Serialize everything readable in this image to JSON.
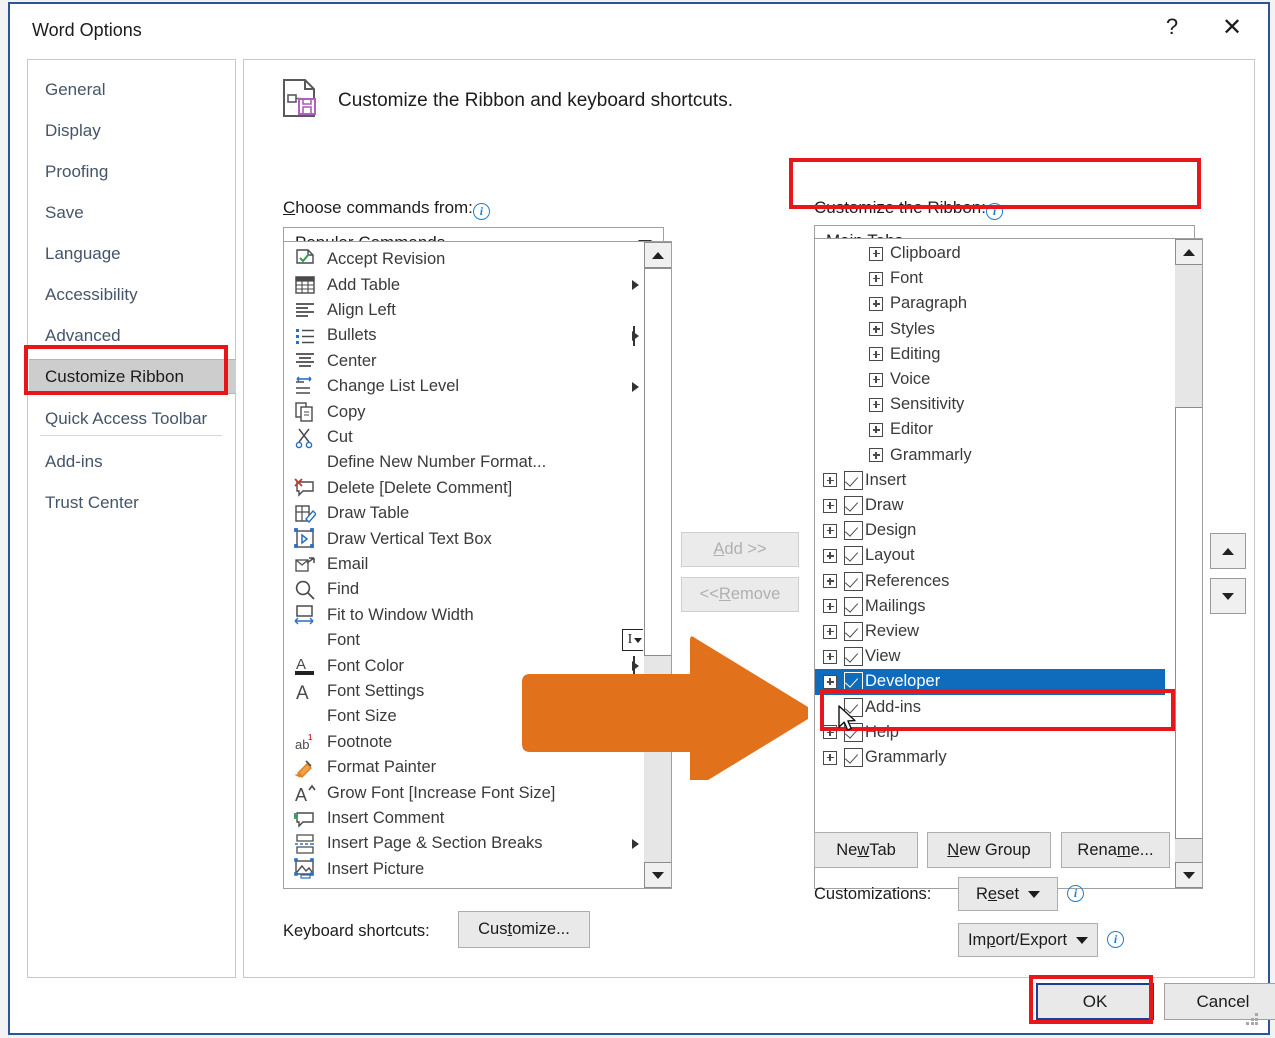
{
  "window": {
    "title": "Word Options",
    "help_button": "?",
    "close_button": "✕"
  },
  "sidebar": {
    "items": [
      {
        "label": "General",
        "selected": false
      },
      {
        "label": "Display",
        "selected": false
      },
      {
        "label": "Proofing",
        "selected": false
      },
      {
        "label": "Save",
        "selected": false
      },
      {
        "label": "Language",
        "selected": false
      },
      {
        "label": "Accessibility",
        "selected": false
      },
      {
        "label": "Advanced",
        "selected": false
      },
      {
        "label": "Customize Ribbon",
        "selected": true
      },
      {
        "label": "Quick Access Toolbar",
        "selected": false
      },
      {
        "label": "Add-ins",
        "selected": false
      },
      {
        "label": "Trust Center",
        "selected": false
      }
    ]
  },
  "header": {
    "title": "Customize the Ribbon and keyboard shortcuts.",
    "icon": "customize-ribbon-icon"
  },
  "left_panel": {
    "label_prefix": "C",
    "label_rest": "hoose commands from:",
    "combo_value": "Popular Commands",
    "commands": [
      {
        "label": "Accept Revision",
        "icon": "accept-revision-icon",
        "submenu": false
      },
      {
        "label": "Add Table",
        "icon": "add-table-icon",
        "submenu": true
      },
      {
        "label": "Align Left",
        "icon": "align-left-icon",
        "submenu": false
      },
      {
        "label": "Bullets",
        "icon": "bullets-icon",
        "submenu": true
      },
      {
        "label": "Center",
        "icon": "center-icon",
        "submenu": false
      },
      {
        "label": "Change List Level",
        "icon": "change-list-level-icon",
        "submenu": true
      },
      {
        "label": "Copy",
        "icon": "copy-icon",
        "submenu": false
      },
      {
        "label": "Cut",
        "icon": "cut-icon",
        "submenu": false
      },
      {
        "label": "Define New Number Format...",
        "icon": "none",
        "submenu": false
      },
      {
        "label": "Delete [Delete Comment]",
        "icon": "delete-comment-icon",
        "submenu": false
      },
      {
        "label": "Draw Table",
        "icon": "draw-table-icon",
        "submenu": false
      },
      {
        "label": "Draw Vertical Text Box",
        "icon": "draw-vertical-text-box-icon",
        "submenu": false
      },
      {
        "label": "Email",
        "icon": "email-icon",
        "submenu": false
      },
      {
        "label": "Find",
        "icon": "find-icon",
        "submenu": false
      },
      {
        "label": "Fit to Window Width",
        "icon": "fit-to-window-width-icon",
        "submenu": false
      },
      {
        "label": "Font",
        "icon": "none",
        "submenu": false
      },
      {
        "label": "Font Color",
        "icon": "font-color-icon",
        "submenu": true
      },
      {
        "label": "Font Settings",
        "icon": "font-settings-icon",
        "submenu": false
      },
      {
        "label": "Font Size",
        "icon": "none",
        "submenu": false
      },
      {
        "label": "Footnote",
        "icon": "footnote-icon",
        "submenu": false
      },
      {
        "label": "Format Painter",
        "icon": "format-painter-icon",
        "submenu": false
      },
      {
        "label": "Grow Font [Increase Font Size]",
        "icon": "grow-font-icon",
        "submenu": false
      },
      {
        "label": "Insert Comment",
        "icon": "insert-comment-icon",
        "submenu": false
      },
      {
        "label": "Insert Page & Section Breaks",
        "icon": "insert-breaks-icon",
        "submenu": true
      },
      {
        "label": "Insert Picture",
        "icon": "insert-picture-icon",
        "submenu": false
      }
    ]
  },
  "transfer_buttons": {
    "add": {
      "acc": "A",
      "rest": "dd >>",
      "disabled": true
    },
    "remove": {
      "pre": "<< ",
      "acc": "R",
      "rest": "emove",
      "disabled": true
    }
  },
  "right_panel": {
    "label": "Customize the Ribbon:",
    "combo_value": "Main Tabs",
    "tree": [
      {
        "label": "Clipboard",
        "level": "group",
        "expandable": true,
        "checked": null,
        "selected": false
      },
      {
        "label": "Font",
        "level": "group",
        "expandable": true,
        "checked": null,
        "selected": false
      },
      {
        "label": "Paragraph",
        "level": "group",
        "expandable": true,
        "checked": null,
        "selected": false
      },
      {
        "label": "Styles",
        "level": "group",
        "expandable": true,
        "checked": null,
        "selected": false
      },
      {
        "label": "Editing",
        "level": "group",
        "expandable": true,
        "checked": null,
        "selected": false
      },
      {
        "label": "Voice",
        "level": "group",
        "expandable": true,
        "checked": null,
        "selected": false
      },
      {
        "label": "Sensitivity",
        "level": "group",
        "expandable": true,
        "checked": null,
        "selected": false
      },
      {
        "label": "Editor",
        "level": "group",
        "expandable": true,
        "checked": null,
        "selected": false
      },
      {
        "label": "Grammarly",
        "level": "group",
        "expandable": true,
        "checked": null,
        "selected": false
      },
      {
        "label": "Insert",
        "level": "tab",
        "expandable": true,
        "checked": true,
        "selected": false
      },
      {
        "label": "Draw",
        "level": "tab",
        "expandable": true,
        "checked": true,
        "selected": false
      },
      {
        "label": "Design",
        "level": "tab",
        "expandable": true,
        "checked": true,
        "selected": false
      },
      {
        "label": "Layout",
        "level": "tab",
        "expandable": true,
        "checked": true,
        "selected": false
      },
      {
        "label": "References",
        "level": "tab",
        "expandable": true,
        "checked": true,
        "selected": false
      },
      {
        "label": "Mailings",
        "level": "tab",
        "expandable": true,
        "checked": true,
        "selected": false
      },
      {
        "label": "Review",
        "level": "tab",
        "expandable": true,
        "checked": true,
        "selected": false
      },
      {
        "label": "View",
        "level": "tab",
        "expandable": true,
        "checked": true,
        "selected": false
      },
      {
        "label": "Developer",
        "level": "tab",
        "expandable": true,
        "checked": true,
        "selected": true
      },
      {
        "label": "Add-ins",
        "level": "tab",
        "expandable": false,
        "checked": true,
        "selected": false
      },
      {
        "label": "Help",
        "level": "tab",
        "expandable": true,
        "checked": true,
        "selected": false
      },
      {
        "label": "Grammarly",
        "level": "tab",
        "expandable": true,
        "checked": true,
        "selected": false
      }
    ],
    "move_up": "move-up-arrow",
    "move_down": "move-down-arrow",
    "buttons": {
      "new_tab": {
        "pre": "Ne",
        "acc": "w",
        "post": " Tab"
      },
      "new_group": {
        "pre": "",
        "acc": "N",
        "post": "ew Group"
      },
      "rename": {
        "pre": "Rena",
        "acc": "m",
        "post": "e..."
      }
    },
    "customizations_label": "Customizations:",
    "reset": {
      "pre": "R",
      "acc": "e",
      "post": "set"
    },
    "import_export": {
      "pre": "Im",
      "acc": "p",
      "post": "ort/Export"
    }
  },
  "keyboard_shortcuts": {
    "label": "Keyboard shortcuts:",
    "button": {
      "pre": "Cus",
      "acc": "t",
      "post": "omize..."
    }
  },
  "footer": {
    "ok": "OK",
    "cancel": "Cancel"
  },
  "annotations": {
    "highlight_color": "#e8161a",
    "arrow_color": "#e2711b",
    "selection_color": "#0f6cbd"
  }
}
